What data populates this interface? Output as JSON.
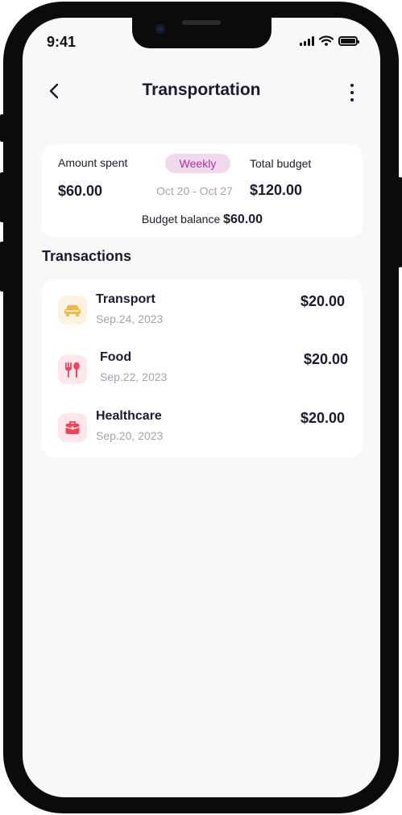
{
  "status_bar": {
    "time": "9:41"
  },
  "header": {
    "title": "Transportation"
  },
  "summary": {
    "amount_spent_label": "Amount spent",
    "amount_spent_value": "$60.00",
    "period": "Weekly",
    "date_range": "Oct 20 - Oct 27",
    "total_budget_label": "Total budget",
    "total_budget_value": "$120.00",
    "balance_label": "Budget balance",
    "balance_value": "$60.00"
  },
  "transactions": {
    "title": "Transactions",
    "items": [
      {
        "name": "Transport",
        "date": "Sep.24, 2023",
        "amount": "$20.00",
        "icon": "car-icon",
        "icon_bg": "#fdf3e0",
        "icon_color": "#f4b73f"
      },
      {
        "name": "Food",
        "date": "Sep.22, 2023",
        "amount": "$20.00",
        "icon": "cutlery-icon",
        "icon_bg": "#fde7ea",
        "icon_color": "#f0445a"
      },
      {
        "name": "Healthcare",
        "date": "Sep.20, 2023",
        "amount": "$20.00",
        "icon": "medical-kit-icon",
        "icon_bg": "#fde7ea",
        "icon_color": "#f0445a"
      }
    ]
  },
  "colors": {
    "accent_pill_bg": "#f1d8ec",
    "accent_pill_text": "#a8379c",
    "text_primary": "#1b1b2f",
    "text_muted": "#a3a3ad",
    "screen_bg": "#f8f8f8"
  }
}
